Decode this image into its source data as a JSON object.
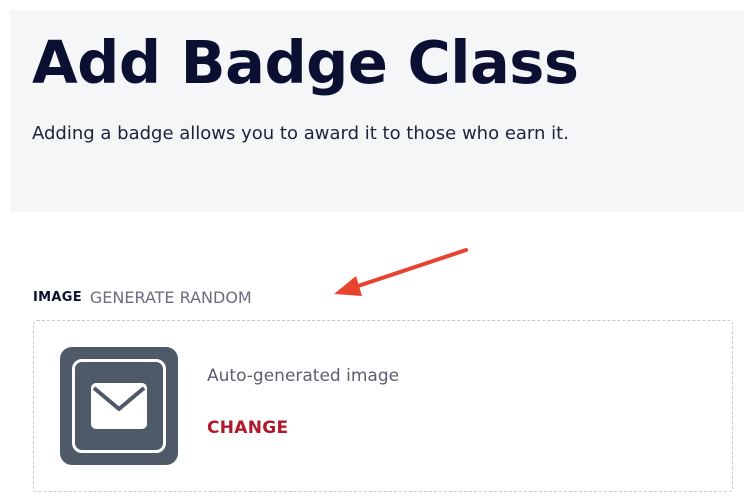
{
  "header": {
    "title": "Add Badge Class",
    "subtitle": "Adding a badge allows you to award it to those who earn it."
  },
  "image_field": {
    "label": "IMAGE",
    "generate_random_label": "GENERATE RANDOM",
    "caption": "Auto-generated image",
    "change_label": "CHANGE",
    "preview_icon": "envelope-icon"
  },
  "annotation": {
    "arrow_icon": "arrow-icon"
  },
  "colors": {
    "title": "#0b1033",
    "header_background": "#f5f6f8",
    "badge_background": "#4f5a68",
    "change_link": "#b0192c",
    "arrow": "#e8432f"
  }
}
